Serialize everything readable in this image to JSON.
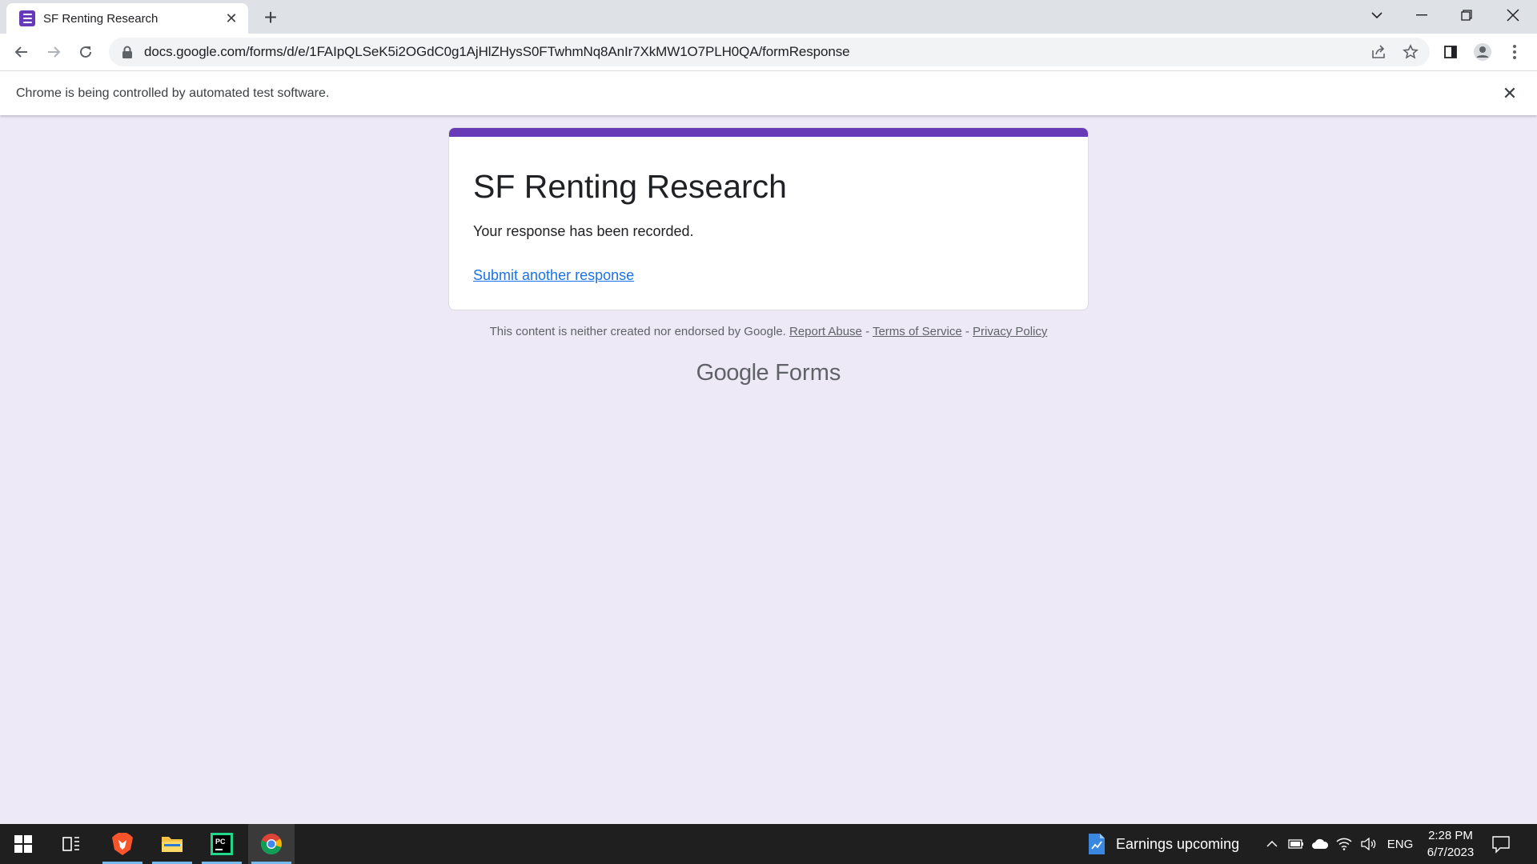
{
  "browser": {
    "tab_title": "SF Renting Research",
    "url": "docs.google.com/forms/d/e/1FAIpQLSeK5i2OGdC0g1AjHlZHysS0FTwhmNq8AnIr7XkMW1O7PLH0QA/formResponse",
    "infobar_text": "Chrome is being controlled by automated test software."
  },
  "form": {
    "title": "SF Renting Research",
    "message": "Your response has been recorded.",
    "link": "Submit another response",
    "accent_color": "#673ab7"
  },
  "footer": {
    "disclaimer": "This content is neither created nor endorsed by Google.",
    "report_abuse": "Report Abuse",
    "sep1": " - ",
    "terms": "Terms of Service",
    "sep2": " - ",
    "privacy": "Privacy Policy",
    "brand_google": "Google",
    "brand_forms": "Forms"
  },
  "taskbar": {
    "apps": [
      "windows-start",
      "task-view",
      "brave-browser",
      "file-explorer",
      "pycharm",
      "chrome"
    ],
    "news_text": "Earnings upcoming",
    "lang": "ENG",
    "time": "2:28 PM",
    "date": "6/7/2023"
  }
}
